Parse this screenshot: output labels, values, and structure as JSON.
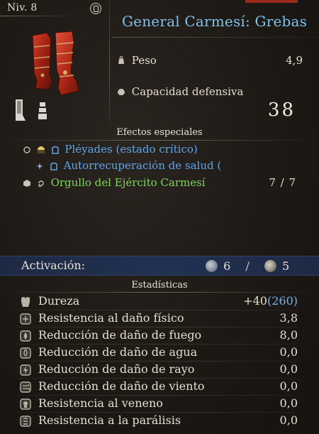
{
  "header": {
    "level_label": "Niv. 8",
    "item_name": "General Carmesí: Grebas"
  },
  "weight": {
    "label": "Peso",
    "value": "4,9",
    "icon": "weight-icon"
  },
  "defense": {
    "label": "Capacidad defensiva",
    "value": "38",
    "icon": "helmet-icon"
  },
  "special_effects": {
    "title": "Efectos especiales",
    "items": [
      {
        "label": "Pléyades (estado crítico)",
        "color": "#5ea5ee"
      },
      {
        "label": "Autorrecuperación de salud (",
        "color": "#5ea5ee"
      },
      {
        "label": "Orgullo del Ejército Carmesí",
        "color": "#7dd65a",
        "count": "7 / 7"
      }
    ]
  },
  "activation": {
    "label": "Activación:",
    "value_a": "6",
    "separator": "/",
    "value_b": "5"
  },
  "stats": {
    "title": "Estadísticas",
    "rows": [
      {
        "label": "Dureza",
        "value": "+40",
        "value_extra": "(260)",
        "icon": "armor-icon"
      },
      {
        "label": "Resistencia al daño físico",
        "value": "3,8",
        "icon": "physical-resist-icon"
      },
      {
        "label": "Reducción de daño de fuego",
        "value": "8,0",
        "icon": "fire-icon"
      },
      {
        "label": "Reducción de daño de agua",
        "value": "0,0",
        "icon": "water-icon"
      },
      {
        "label": "Reducción de daño de rayo",
        "value": "0,0",
        "icon": "lightning-icon"
      },
      {
        "label": "Reducción de daño de viento",
        "value": "0,0",
        "icon": "wind-icon"
      },
      {
        "label": "Resistencia al veneno",
        "value": "0,0",
        "icon": "poison-icon"
      },
      {
        "label": "Resistencia a la parálisis",
        "value": "0,0",
        "icon": "paralysis-icon"
      }
    ]
  }
}
